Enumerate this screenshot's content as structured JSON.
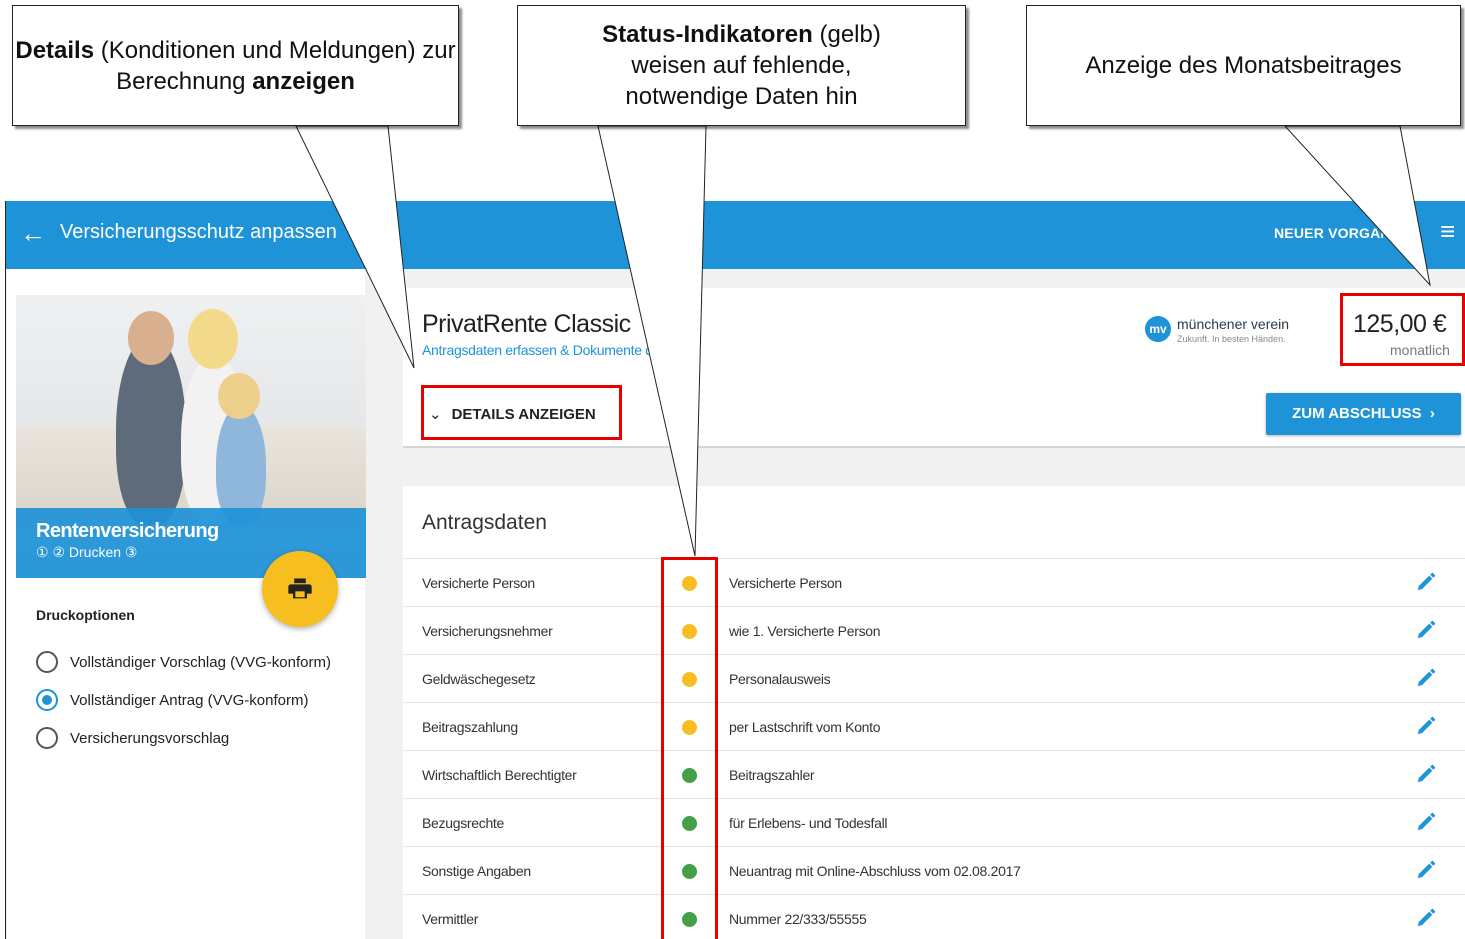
{
  "appbar": {
    "back_icon": "arrow-left-icon",
    "title": "Versicherungsschutz anpassen",
    "new_process": "NEUER VORGANG",
    "menu_icon": "hamburger-menu-icon",
    "color": "#1e93d8"
  },
  "sidebar": {
    "hero_title": "Rentenversicherung",
    "steps": "① ② Drucken ③",
    "fab_icon": "printer-icon",
    "fab_color": "#f6bf1f",
    "print_options_title": "Druckoptionen",
    "options": [
      {
        "label": "Vollständiger Vorschlag (VVG-konform)",
        "checked": false
      },
      {
        "label": "Vollständiger Antrag (VVG-konform)",
        "checked": true
      },
      {
        "label": "Versicherungsvorschlag",
        "checked": false
      }
    ]
  },
  "product": {
    "name": "PrivatRente Classic",
    "subtitle": "Antragsdaten erfassen & Dokumente drucken",
    "details_button": "DETAILS ANZEIGEN",
    "logo_mark": "mv",
    "logo_name": "münchener verein",
    "logo_claim": "Zukunft. In besten Händen.",
    "price": "125,00 €",
    "price_unit": "monatlich",
    "cta": "ZUM ABSCHLUSS"
  },
  "application": {
    "title": "Antragsdaten",
    "status_colors": {
      "missing": "#f6bf1f",
      "ok": "#43a047"
    },
    "rows": [
      {
        "label": "Versicherte Person",
        "status": "missing",
        "value": "Versicherte Person"
      },
      {
        "label": "Versicherungsnehmer",
        "status": "missing",
        "value": "wie 1. Versicherte Person"
      },
      {
        "label": "Geldwäschegesetz",
        "status": "missing",
        "value": "Personalausweis"
      },
      {
        "label": "Beitragszahlung",
        "status": "missing",
        "value": "per Lastschrift vom Konto"
      },
      {
        "label": "Wirtschaftlich Berechtigter",
        "status": "ok",
        "value": "Beitragszahler"
      },
      {
        "label": "Bezugsrechte",
        "status": "ok",
        "value": "für Erlebens- und Todesfall"
      },
      {
        "label": "Sonstige Angaben",
        "status": "ok",
        "value": "Neuantrag mit Online-Abschluss vom 02.08.2017"
      },
      {
        "label": "Vermittler",
        "status": "ok",
        "value": "Nummer 22/333/55555"
      }
    ]
  },
  "annotations": {
    "callout1": {
      "bold_start": "Details",
      "text_mid": " (Konditionen und Meldungen) zur Berechnung ",
      "bold_end": "anzeigen"
    },
    "callout2": {
      "bold_start": "Status-Indikatoren",
      "text_mid": " (gelb) weisen auf fehlende, notwendige Daten hin"
    },
    "callout3": {
      "text": "Anzeige des Monatsbeitrages"
    },
    "highlight_color": "#e60000"
  }
}
